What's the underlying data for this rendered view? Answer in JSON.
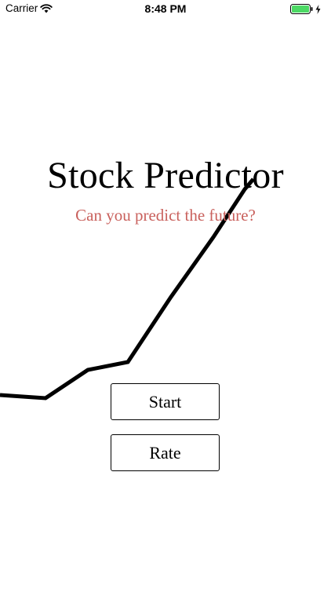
{
  "status_bar": {
    "carrier": "Carrier",
    "time": "8:48 PM",
    "wifi_icon": "wifi-icon",
    "battery_icon": "battery-charging-icon",
    "battery_level": 1.0,
    "battery_color": "#4cd964"
  },
  "main": {
    "title": "Stock Predictor",
    "subtitle": "Can you predict the future?",
    "subtitle_color": "#c9615d"
  },
  "buttons": {
    "start_label": "Start",
    "rate_label": "Rate"
  },
  "colors": {
    "background": "#ffffff",
    "line": "#000000"
  }
}
